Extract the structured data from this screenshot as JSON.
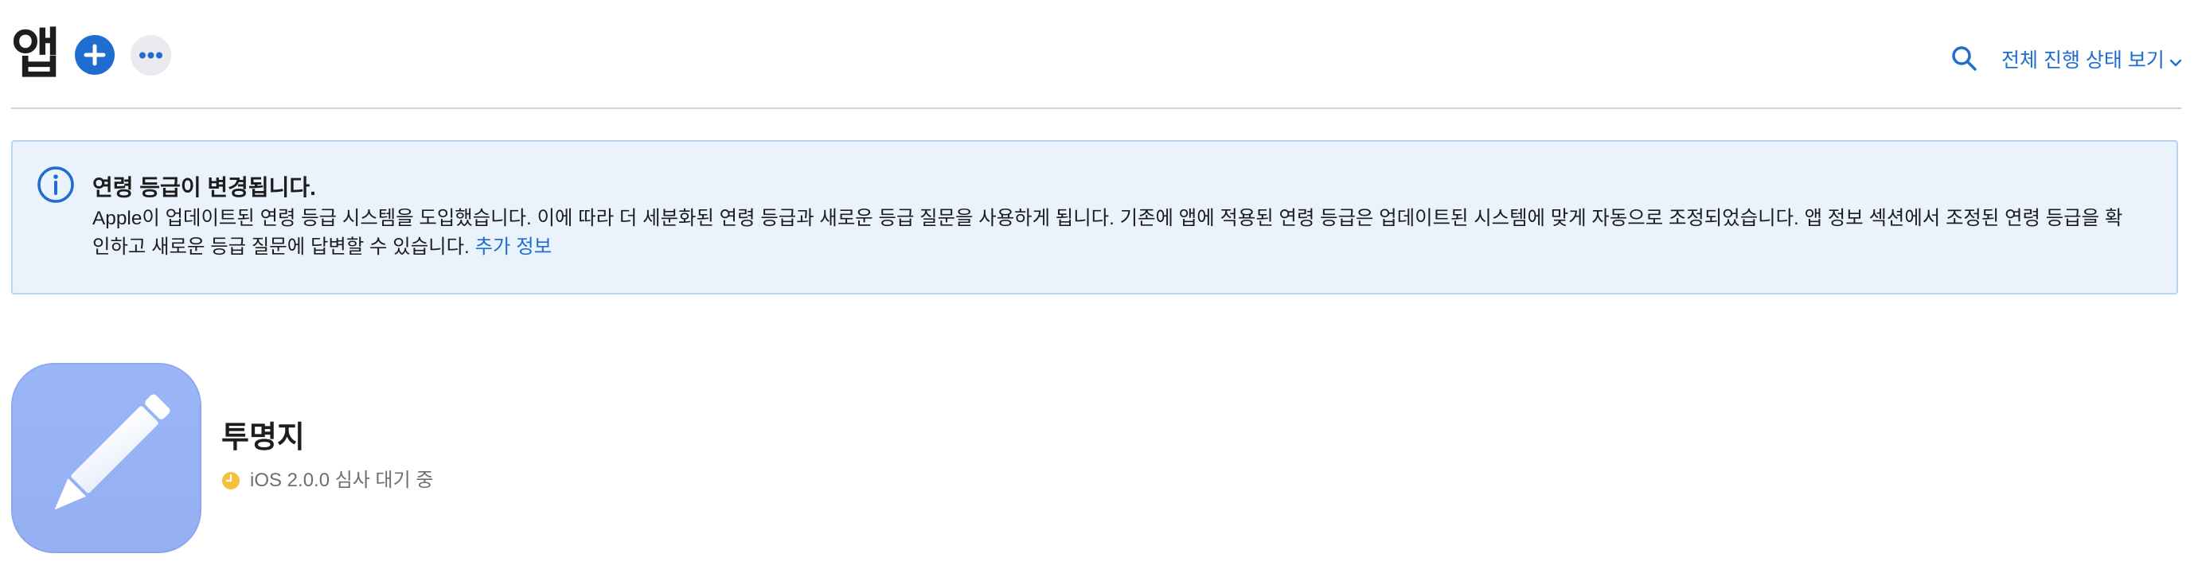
{
  "header": {
    "title": "앱",
    "progress_link": "전체 진행 상태 보기"
  },
  "icons": {
    "add": "plus-icon",
    "more": "ellipsis-icon",
    "search": "search-icon",
    "chevron": "chevron-down-icon",
    "info": "info-circle-icon",
    "app": "pencil-icon",
    "status": "clock-icon"
  },
  "colors": {
    "accent": "#1f6dd1",
    "banner_background": "#eaf2fb",
    "banner_border": "#bcd3ee",
    "app_icon": "#9bb6f7",
    "pending_status": "#f5c13b"
  },
  "banner": {
    "title": "연령 등급이 변경됩니다.",
    "text_line1": "Apple이 업데이트된 연령 등급 시스템을 도입했습니다. 이에 따라 더 세분화된 연령 등급과 새로운 등급 질문을 사용하게 됩니다. 기존에 앱에 적용된 연령 등급은 업데이트된 시스템에 맞게 자동으로 조정되었습니다. 앱 정보 섹션에서 조정된 연령 등급을 확",
    "text_line2": "인하고 새로운 등급 질문에 답변할 수 있습니다.",
    "link": "추가 정보"
  },
  "apps": [
    {
      "name": "투명지",
      "status": "iOS 2.0.0 심사 대기 중"
    }
  ]
}
